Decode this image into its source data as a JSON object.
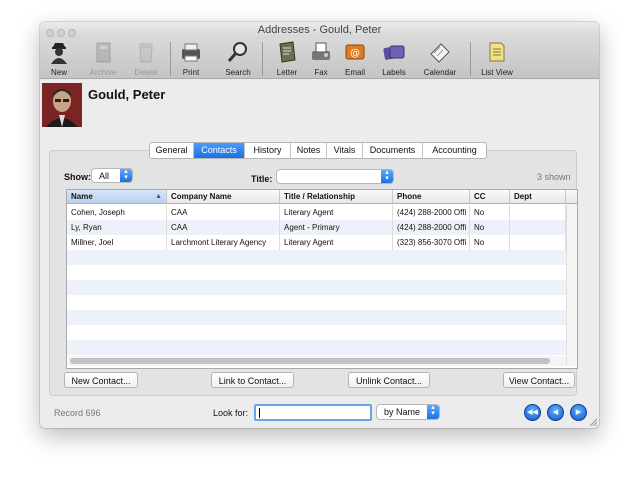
{
  "window": {
    "title": "Addresses - Gould, Peter"
  },
  "toolbar": {
    "items": [
      {
        "label": "New",
        "icon": "person-silhouette-icon",
        "enabled": true
      },
      {
        "label": "Archive",
        "icon": "archive-box-icon",
        "enabled": false
      },
      {
        "label": "Delete",
        "icon": "trash-can-icon",
        "enabled": false
      },
      {
        "label": "Print",
        "icon": "printer-icon",
        "enabled": true
      },
      {
        "label": "Search",
        "icon": "magnifier-icon",
        "enabled": true
      },
      {
        "label": "Letter",
        "icon": "letter-icon",
        "enabled": true
      },
      {
        "label": "Fax",
        "icon": "fax-machine-icon",
        "enabled": true
      },
      {
        "label": "Email",
        "icon": "email-icon",
        "enabled": true
      },
      {
        "label": "Labels",
        "icon": "labels-icon",
        "enabled": true
      },
      {
        "label": "Calendar",
        "icon": "calendar-icon",
        "enabled": true
      },
      {
        "label": "List View",
        "icon": "list-view-icon",
        "enabled": true
      }
    ]
  },
  "record": {
    "name": "Gould, Peter"
  },
  "tabs": [
    {
      "label": "General",
      "active": false
    },
    {
      "label": "Contacts",
      "active": true
    },
    {
      "label": "History",
      "active": false
    },
    {
      "label": "Notes",
      "active": false
    },
    {
      "label": "Vitals",
      "active": false
    },
    {
      "label": "Documents",
      "active": false
    },
    {
      "label": "Accounting",
      "active": false
    }
  ],
  "filters": {
    "show_label": "Show:",
    "show_value": "All",
    "title_label": "Title:",
    "title_value": "",
    "shown_count": "3 shown"
  },
  "table": {
    "columns": [
      "Name",
      "Company Name",
      "Title / Relationship",
      "Phone",
      "CC",
      "Dept"
    ],
    "sorted_column": "Name",
    "rows": [
      [
        "Cohen, Joseph",
        "CAA",
        "Literary Agent",
        "(424) 288-2000 Offi",
        "No",
        ""
      ],
      [
        "Ly, Ryan",
        "CAA",
        "Agent - Primary",
        "(424) 288-2000 Offi",
        "No",
        ""
      ],
      [
        "Millner, Joel",
        "Larchmont Literary Agency",
        "Literary Agent",
        "(323) 856-3070 Offi",
        "No",
        ""
      ]
    ]
  },
  "buttons": {
    "new_contact": "New Contact...",
    "link_contact": "Link to Contact...",
    "unlink_contact": "Unlink Contact...",
    "view_contact": "View Contact..."
  },
  "footer": {
    "record_label": "Record 696",
    "look_for_label": "Look for:",
    "look_for_value": "",
    "search_mode": "by Name"
  },
  "colors": {
    "accent": "#1b6fe0",
    "row_alt": "#edf2fa"
  }
}
